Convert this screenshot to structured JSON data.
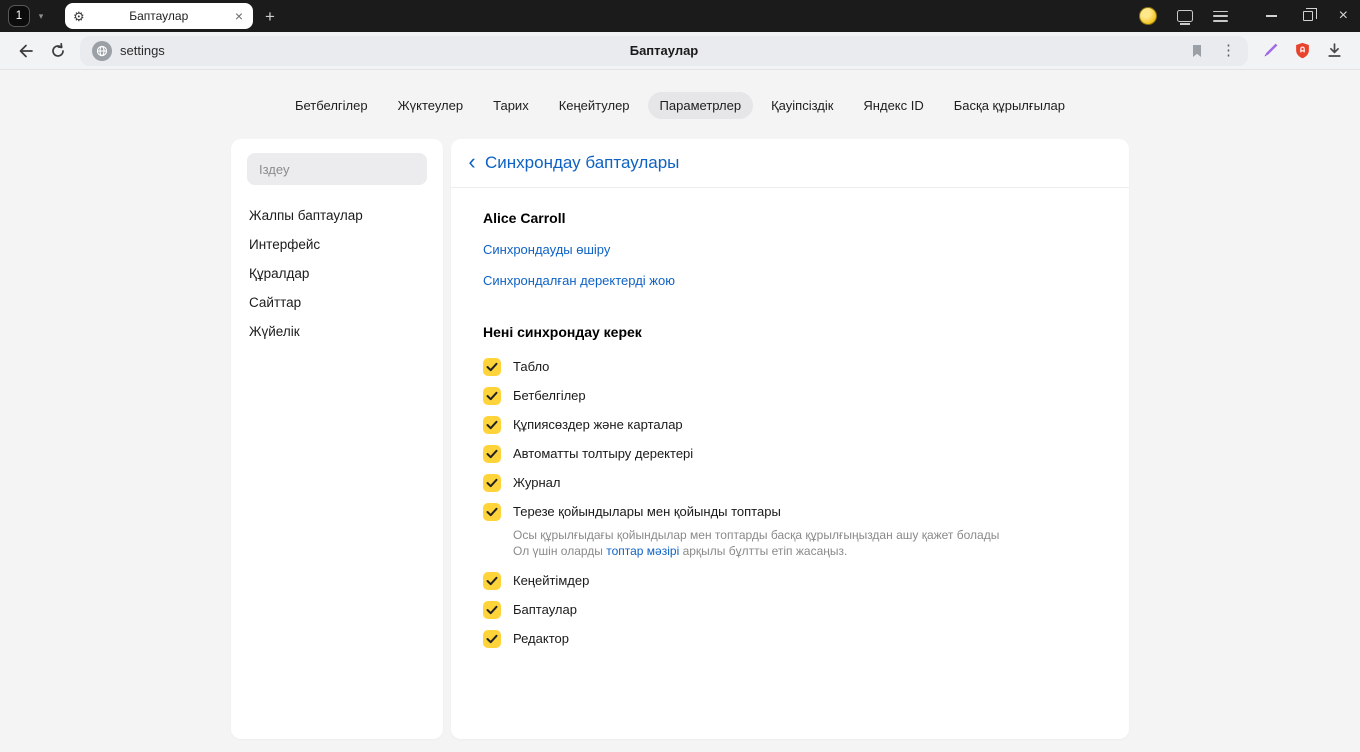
{
  "icons": {
    "chevron_down": "▾",
    "gear": "⚙",
    "close": "×",
    "new_tab": "+",
    "menu_dots": "⋮",
    "back_chevron": "‹"
  },
  "window": {
    "tab_group_badge": "1",
    "tab_title": "Баптаулар"
  },
  "toolbar": {
    "url_text": "settings",
    "page_title": "Баптаулар"
  },
  "nav": {
    "items": [
      {
        "label": "Бетбелгілер",
        "active": false
      },
      {
        "label": "Жүктеулер",
        "active": false
      },
      {
        "label": "Тарих",
        "active": false
      },
      {
        "label": "Кеңейтулер",
        "active": false
      },
      {
        "label": "Параметрлер",
        "active": true
      },
      {
        "label": "Қауіпсіздік",
        "active": false
      },
      {
        "label": "Яндекс ID",
        "active": false
      },
      {
        "label": "Басқа құрылғылар",
        "active": false
      }
    ]
  },
  "sidebar": {
    "search_placeholder": "Іздеу",
    "items": [
      {
        "label": "Жалпы баптаулар"
      },
      {
        "label": "Интерфейс"
      },
      {
        "label": "Құралдар"
      },
      {
        "label": "Сайттар"
      },
      {
        "label": "Жүйелік"
      }
    ]
  },
  "main": {
    "title": "Синхрондау баптаулары",
    "account_name": "Alice Carroll",
    "link_disable_sync": "Синхрондауды өшіру",
    "link_delete_synced": "Синхрондалған деректерді жою",
    "section_title": "Нені синхрондау керек",
    "items": [
      {
        "label": "Табло",
        "checked": true
      },
      {
        "label": "Бетбелгілер",
        "checked": true
      },
      {
        "label": "Құпиясөздер және карталар",
        "checked": true
      },
      {
        "label": "Автоматты толтыру деректері",
        "checked": true
      },
      {
        "label": "Журнал",
        "checked": true
      },
      {
        "label": "Терезе қойындылары мен қойынды топтары",
        "checked": true,
        "note_line1": "Осы құрылғыдағы қойындылар мен топтарды басқа құрылғыңыздан ашу қажет болады",
        "note_line2_prefix": "Ол үшін оларды ",
        "note_link": "топтар мәзірі",
        "note_line2_suffix": " арқылы бұлтты етіп жасаңыз."
      },
      {
        "label": "Кеңейтімдер",
        "checked": true
      },
      {
        "label": "Баптаулар",
        "checked": true
      },
      {
        "label": "Редактор",
        "checked": true
      }
    ]
  },
  "colors": {
    "accent_blue": "#0e62c4",
    "checkbox_yellow": "#ffd43b",
    "protect_red": "#e8432d",
    "pen_purple": "#a06ae8"
  }
}
